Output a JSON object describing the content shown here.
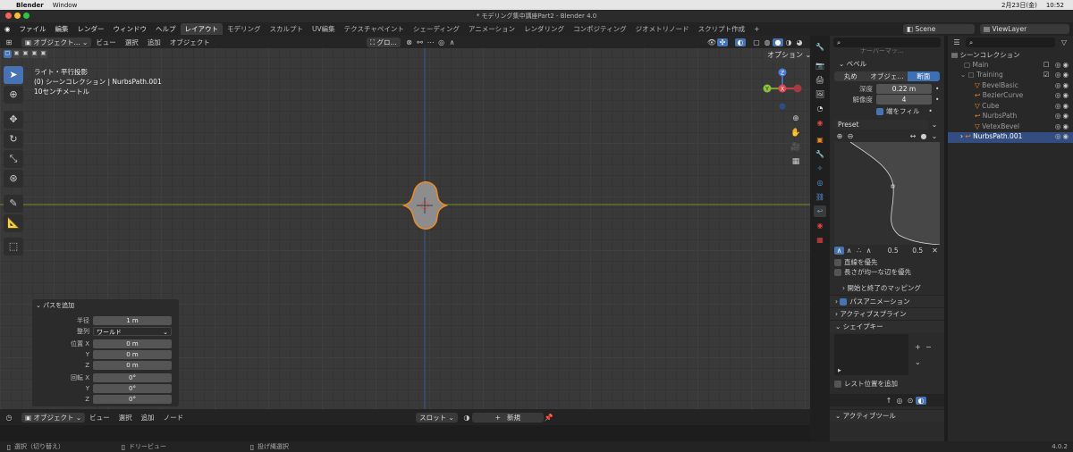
{
  "mac": {
    "apple": "",
    "app": "Blender",
    "menu": "Window",
    "date": "2月23日(金)",
    "time": "10:52"
  },
  "window": {
    "title": "* モデリング集中講座Part2 - Blender 4.0"
  },
  "menu": {
    "items": [
      "ファイル",
      "編集",
      "レンダー",
      "ウィンドウ",
      "ヘルプ"
    ],
    "tabs": [
      {
        "label": "レイアウト",
        "active": true
      },
      {
        "label": "モデリング"
      },
      {
        "label": "スカルプト"
      },
      {
        "label": "UV編集"
      },
      {
        "label": "テクスチャペイント"
      },
      {
        "label": "シェーディング"
      },
      {
        "label": "アニメーション"
      },
      {
        "label": "レンダリング"
      },
      {
        "label": "コンポジティング"
      },
      {
        "label": "ジオメトリノード"
      },
      {
        "label": "スクリプト作成"
      }
    ],
    "add_tab": "+",
    "scene": "Scene",
    "view_layer": "ViewLayer"
  },
  "viewport": {
    "mode": "オブジェクト...",
    "menus": [
      "ビュー",
      "選択",
      "追加",
      "オブジェクト"
    ],
    "orientation": "グロ...",
    "options": "オプション",
    "info_lines": [
      "ライト・平行投影",
      "(0) シーンコレクション | NurbsPath.001",
      "10センチメートル"
    ],
    "gizmo": {
      "x": "X",
      "y": "Y",
      "z": "Z"
    }
  },
  "redo_panel": {
    "title": "パスを追加",
    "rows": [
      {
        "label": "半径",
        "value": "1 m"
      },
      {
        "label": "整列",
        "value": "ワールド",
        "dropdown": true
      },
      {
        "label": "位置 X",
        "value": "0 m"
      },
      {
        "label": "Y",
        "value": "0 m"
      },
      {
        "label": "Z",
        "value": "0 m"
      },
      {
        "label": "回転 X",
        "value": "0°"
      },
      {
        "label": "Y",
        "value": "0°"
      },
      {
        "label": "Z",
        "value": "0°"
      }
    ]
  },
  "timeline": {
    "mode": "オブジェクト",
    "menus": [
      "ビュー",
      "選択",
      "追加",
      "ノード"
    ],
    "slot": "スロット",
    "new": "新規"
  },
  "status": {
    "select": "選択（切り替え）",
    "dolly": "ドリービュー",
    "lasso": "投げ縄選択",
    "version": "4.0.2"
  },
  "properties": {
    "cut_header": "ナーバーマッ...",
    "bevel_title": "ベベル",
    "bevel_modes": [
      {
        "label": "丸め"
      },
      {
        "label": "オブジェ..."
      },
      {
        "label": "断面",
        "active": true
      }
    ],
    "depth_label": "深度",
    "depth_value": "0.22 m",
    "res_label": "解像度",
    "res_value": "4",
    "fill_caps": "端をフィル",
    "preset": "Preset",
    "curve_v1": "0.5",
    "curve_v2": "0.5",
    "straight_edges": "直線を優先",
    "even_length": "長さが均一な辺を優先",
    "start_end_mapping": "開始と終了のマッピング",
    "path_animation": "パスアニメーション",
    "active_spline": "アクティブスプライン",
    "shape_keys": "シェイプキー",
    "add_rest_position": "レスト位置を追加",
    "active_tool": "アクティブツール"
  },
  "outliner": {
    "root": "シーンコレクション",
    "items": [
      {
        "label": "Main",
        "indent": 1,
        "muted": true
      },
      {
        "label": "Training",
        "indent": 1,
        "muted": true
      },
      {
        "label": "BevelBasic",
        "indent": 2,
        "muted": true
      },
      {
        "label": "BezierCurve",
        "indent": 2,
        "muted": true
      },
      {
        "label": "Cube",
        "indent": 2,
        "muted": true
      },
      {
        "label": "NurbsPath",
        "indent": 2,
        "muted": true
      },
      {
        "label": "VetexBevel",
        "indent": 2,
        "muted": true
      },
      {
        "label": "NurbsPath.001",
        "indent": 1,
        "selected": true
      }
    ]
  },
  "colors": {
    "accent": "#4772b3",
    "x_axis": "#e8464f",
    "y_axis": "#8ac43b",
    "z_axis": "#4a7fd6",
    "selection_outline": "#f08a24"
  }
}
